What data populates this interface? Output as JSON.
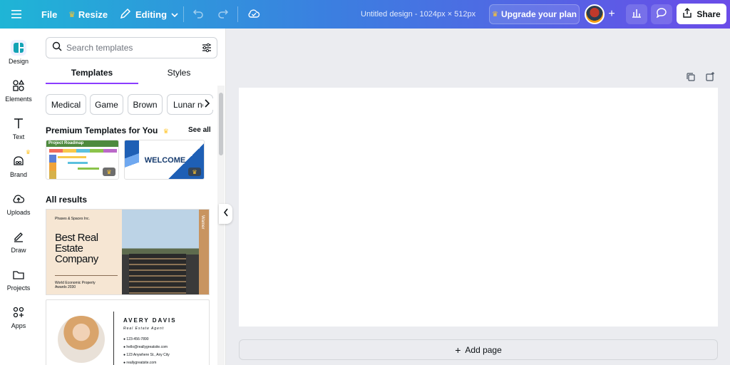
{
  "topbar": {
    "file_label": "File",
    "resize_label": "Resize",
    "editing_label": "Editing",
    "doc_title": "Untitled design - 1024px × 512px",
    "upgrade_label": "Upgrade your plan",
    "share_label": "Share"
  },
  "rail": {
    "items": [
      {
        "label": "Design",
        "icon": "design-icon"
      },
      {
        "label": "Elements",
        "icon": "elements-icon"
      },
      {
        "label": "Text",
        "icon": "text-icon"
      },
      {
        "label": "Brand",
        "icon": "brand-icon"
      },
      {
        "label": "Uploads",
        "icon": "uploads-icon"
      },
      {
        "label": "Draw",
        "icon": "draw-icon"
      },
      {
        "label": "Projects",
        "icon": "projects-icon"
      },
      {
        "label": "Apps",
        "icon": "apps-icon"
      }
    ]
  },
  "panel": {
    "search_placeholder": "Search templates",
    "tabs": [
      "Templates",
      "Styles"
    ],
    "chips": [
      "Medical",
      "Game",
      "Brown",
      "Lunar ne"
    ],
    "premium_title": "Premium Templates for You",
    "see_all": "See all",
    "all_results": "All results",
    "t1": {
      "header": "Project Roadmap"
    },
    "t2": {
      "text": "WELCOME"
    },
    "card1": {
      "brand": "Phases & Spaces Inc.",
      "title_lines": [
        "Best Real",
        "Estate",
        "Company"
      ],
      "award": "World Economic Property Awards 2030",
      "side": "Warner"
    },
    "card2": {
      "name": "AVERY DAVIS",
      "role": "Real Estate Agent",
      "phone": "123-456-7890",
      "email": "hello@reallygreatsite.com",
      "address": "123 Anywhere St., Any City",
      "web": "reallygreatsite.com"
    }
  },
  "canvas": {
    "add_page_label": "Add page"
  },
  "colors": {
    "accent": "#8b3dff",
    "crown": "#ffc62e"
  }
}
